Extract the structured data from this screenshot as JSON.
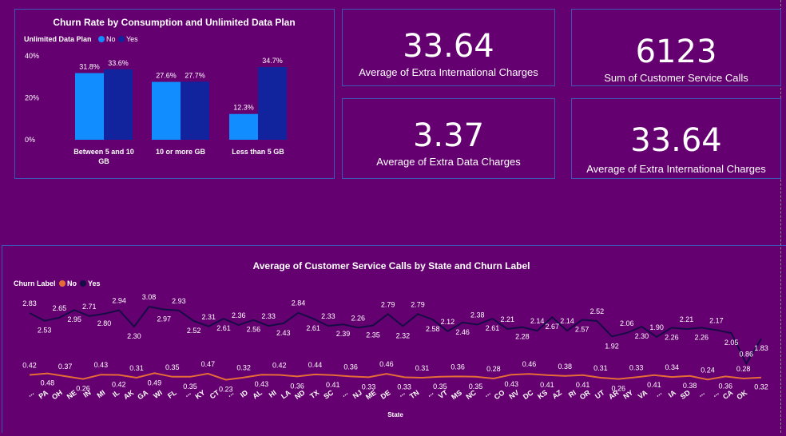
{
  "kpis": [
    {
      "value": "33.64",
      "label": "Average of Extra International Charges"
    },
    {
      "value": "6123",
      "label": "Sum of Customer Service Calls"
    },
    {
      "value": "3.37",
      "label": "Average of Extra Data Charges"
    },
    {
      "value": "33.64",
      "label": "Average of Extra International Charges"
    }
  ],
  "colors": {
    "no": "#118dff",
    "yes": "#12239e",
    "line_no": "#e66c37",
    "line_yes": "#160c45"
  },
  "chart_data": [
    {
      "type": "bar",
      "title": "Churn Rate by Consumption and Unlimited Data Plan",
      "legend_title": "Unlimited Data Plan",
      "legend_position": "top-left",
      "categories": [
        "Between 5 and 10 GB",
        "10 or more GB",
        "Less than 5 GB"
      ],
      "series": [
        {
          "name": "No",
          "values": [
            31.8,
            27.6,
            12.3
          ],
          "labels": [
            "31.8%",
            "27.6%",
            "12.3%"
          ]
        },
        {
          "name": "Yes",
          "values": [
            33.6,
            27.7,
            34.7
          ],
          "labels": [
            "33.6%",
            "27.7%",
            "34.7%"
          ]
        }
      ],
      "yticks": [
        "40%",
        "20%",
        "0%"
      ],
      "ylim": [
        0,
        40
      ],
      "grid": false
    },
    {
      "type": "line",
      "title": "Average of Customer Service Calls by State and Churn Label",
      "legend_title": "Churn Label",
      "legend_position": "top-left",
      "xlabel": "State",
      "categories": [
        "...",
        "PA",
        "OH",
        "NE",
        "IN",
        "MI",
        "IL",
        "AK",
        "GA",
        "WI",
        "FL",
        "...",
        "KY",
        "CT",
        "...",
        "ID",
        "AL",
        "HI",
        "LA",
        "ND",
        "TX",
        "SC",
        "...",
        "NJ",
        "ME",
        "DE",
        "...",
        "TN",
        "...",
        "VT",
        "MS",
        "NC",
        "...",
        "CO",
        "NV",
        "DC",
        "KS",
        "AZ",
        "RI",
        "OR",
        "UT",
        "AR",
        "NY",
        "VA",
        "...",
        "IA",
        "SD",
        "...",
        "...",
        "CA",
        "OK"
      ],
      "series": [
        {
          "name": "No",
          "values": [
            0.42,
            0.48,
            0.37,
            0.26,
            0.43,
            0.42,
            0.31,
            0.49,
            0.35,
            0.35,
            0.47,
            0.23,
            0.32,
            0.43,
            0.42,
            0.36,
            0.44,
            0.41,
            0.36,
            0.33,
            0.46,
            0.33,
            0.31,
            0.35,
            0.36,
            0.35,
            0.28,
            0.43,
            0.46,
            0.41,
            0.38,
            0.41,
            0.31,
            0.26,
            0.33,
            0.41,
            0.34,
            0.38,
            0.24,
            0.36,
            0.28,
            0.32
          ]
        },
        {
          "name": "Yes",
          "values": [
            2.83,
            2.53,
            2.65,
            2.95,
            2.71,
            2.8,
            2.94,
            2.3,
            3.08,
            2.97,
            2.93,
            2.52,
            2.31,
            2.61,
            2.36,
            2.56,
            2.33,
            2.43,
            2.84,
            2.61,
            2.33,
            2.39,
            2.26,
            2.35,
            2.79,
            2.32,
            2.79,
            2.58,
            2.12,
            2.46,
            2.38,
            2.61,
            2.21,
            2.28,
            2.14,
            2.67,
            2.14,
            2.57,
            2.52,
            1.92,
            2.06,
            2.3,
            1.9,
            2.26,
            2.21,
            2.26,
            2.17,
            2.05,
            0.86,
            1.83
          ]
        }
      ],
      "ylim": [
        0,
        3.5
      ],
      "grid": false
    }
  ]
}
